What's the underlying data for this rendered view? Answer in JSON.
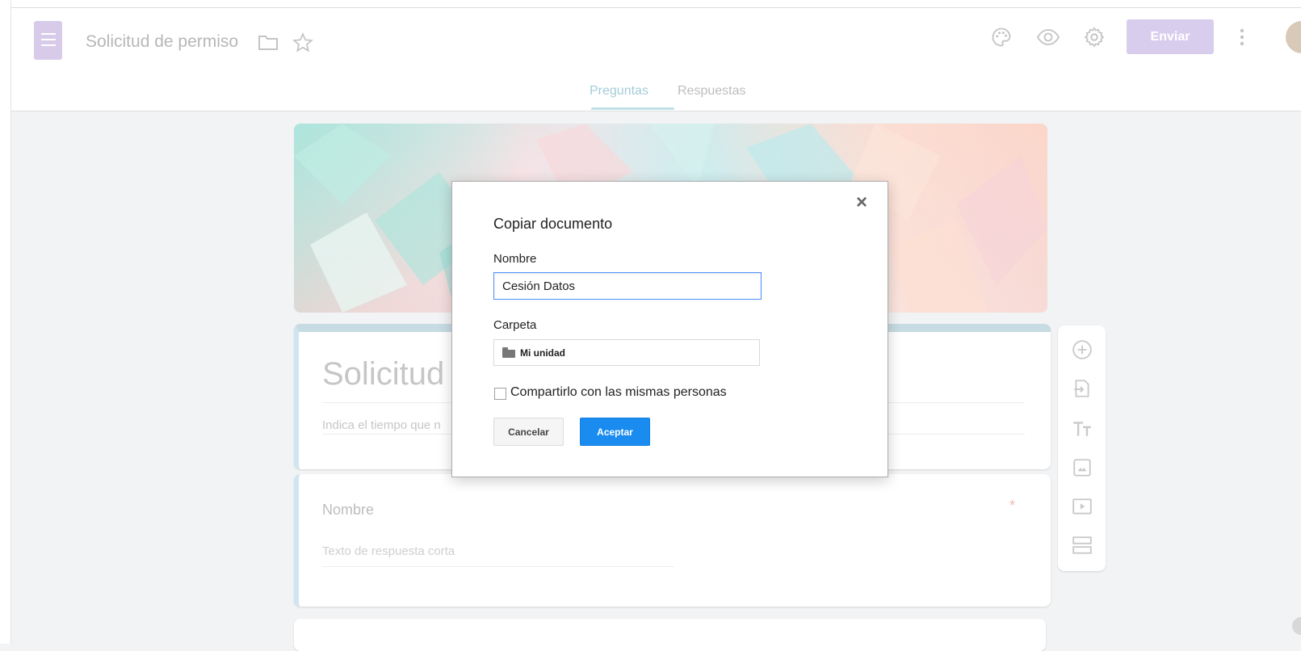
{
  "header": {
    "doc_title": "Solicitud de permiso",
    "send_label": "Enviar"
  },
  "tabs": [
    {
      "label": "Preguntas",
      "active": true
    },
    {
      "label": "Respuestas",
      "active": false
    }
  ],
  "form": {
    "title": "Solicitud d",
    "description": "Indica el tiempo que n",
    "question": {
      "title": "Nombre",
      "hint": "Texto de respuesta corta",
      "required_mark": "*"
    }
  },
  "dialog": {
    "title": "Copiar documento",
    "close_glyph": "×",
    "name_label": "Nombre",
    "name_value": "Cesión Datos",
    "folder_label": "Carpeta",
    "folder_value": "Mi unidad",
    "share_label": "Compartirlo con las mismas personas",
    "share_checked": false,
    "cancel_label": "Cancelar",
    "ok_label": "Aceptar"
  },
  "colors": {
    "accent_blue": "#1a8cf0",
    "send_button": "#d9cdee",
    "tab_active": "#a4ccd8",
    "required": "#f3b6b6"
  },
  "icons": [
    "forms-logo-icon",
    "folder-icon",
    "star-icon",
    "palette-icon",
    "preview-eye-icon",
    "settings-gear-icon",
    "more-vert-icon",
    "add-question-icon",
    "import-questions-icon",
    "add-title-icon",
    "add-image-icon",
    "add-video-icon",
    "add-section-icon",
    "close-icon"
  ]
}
